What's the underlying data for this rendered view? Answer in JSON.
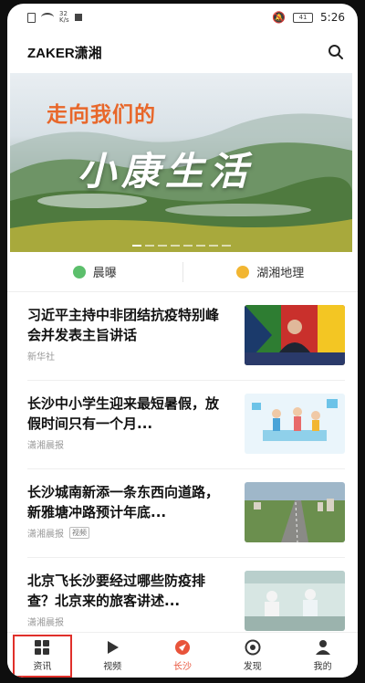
{
  "status": {
    "speed_value": "32",
    "speed_unit": "K/s",
    "battery": "41",
    "time": "5:26"
  },
  "header": {
    "title": "ZAKER潇湘"
  },
  "banner": {
    "headline": "走向我们的",
    "slogan": "小康生活"
  },
  "channels": [
    {
      "label": "晨曝",
      "icon": "leaf-icon",
      "color": "#5cbf6c"
    },
    {
      "label": "湖湘地理",
      "icon": "smile-icon",
      "color": "#f2b632"
    }
  ],
  "news": [
    {
      "title": "习近平主持中非团结抗疫特别峰会并发表主旨讲话",
      "source": "新华社",
      "tag": ""
    },
    {
      "title": "长沙中小学生迎来最短暑假，放假时间只有一个月...",
      "source": "潇湘晨报",
      "tag": ""
    },
    {
      "title": "长沙城南新添一条东西向道路，新雅塘冲路预计年底...",
      "source": "潇湘晨报",
      "tag": "视频"
    },
    {
      "title": "北京飞长沙要经过哪些防疫排查？北京来的旅客讲述...",
      "source": "潇湘晨报",
      "tag": ""
    }
  ],
  "tabs": [
    {
      "label": "资讯",
      "icon": "grid-icon"
    },
    {
      "label": "视频",
      "icon": "play-icon"
    },
    {
      "label": "长沙",
      "icon": "compass-icon"
    },
    {
      "label": "发现",
      "icon": "eye-icon"
    },
    {
      "label": "我的",
      "icon": "user-icon"
    }
  ],
  "colors": {
    "accent": "#e8543b",
    "highlight_box": "#e0302a"
  }
}
